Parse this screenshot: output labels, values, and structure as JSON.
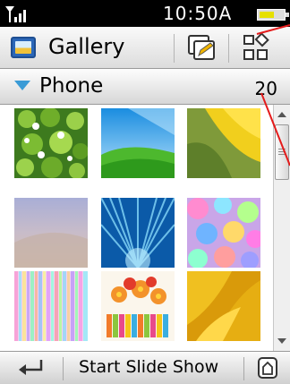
{
  "status_bar": {
    "time": "10:50A",
    "signal_icon": "signal-strength-icon",
    "battery_icon": "battery-icon",
    "battery_level": 0.6,
    "battery_fill_color": "#e6e000"
  },
  "header": {
    "title": "Gallery",
    "app_icon": "gallery-icon",
    "actions": [
      {
        "name": "edit-icon"
      },
      {
        "name": "view-mode-icon"
      }
    ]
  },
  "folder": {
    "name": "Phone",
    "count": "20",
    "expand_icon": "triangle-down-icon",
    "accent": "#3a9bd6"
  },
  "thumbnails": [
    {
      "name": "clover-leaves-thumbnail"
    },
    {
      "name": "green-hills-thumbnail"
    },
    {
      "name": "yellow-tulip-thumbnail"
    },
    {
      "name": "purple-dunes-thumbnail"
    },
    {
      "name": "blue-burst-thumbnail"
    },
    {
      "name": "pastel-bokeh-thumbnail"
    },
    {
      "name": "pastel-stripes-thumbnail"
    },
    {
      "name": "gerbera-flowers-thumbnail"
    },
    {
      "name": "yellow-petals-thumbnail"
    }
  ],
  "scrollbar": {
    "position": 0.0
  },
  "softkeys": {
    "back_icon": "back-arrow-icon",
    "center_label": "Start Slide Show",
    "right_icon": "home-icon"
  }
}
